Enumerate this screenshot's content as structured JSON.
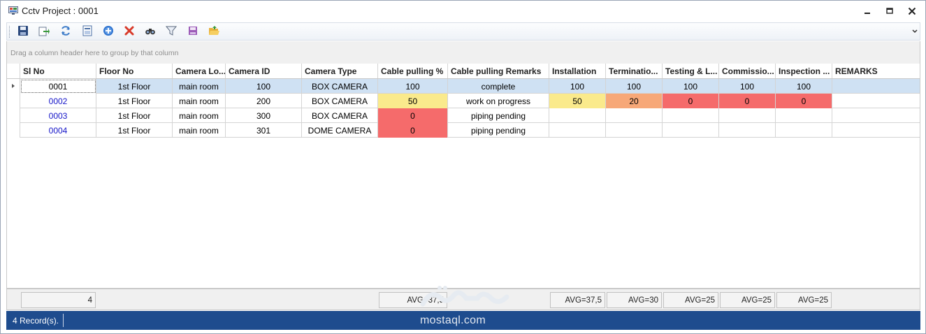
{
  "window": {
    "title": "Cctv Project : 0001"
  },
  "toolbar": {
    "items": [
      "save-icon",
      "export-icon",
      "refresh-icon",
      "report-icon",
      "add-icon",
      "delete-icon",
      "find-icon",
      "filter-icon",
      "layout-icon",
      "open-folder-icon"
    ]
  },
  "group_panel": {
    "hint": "Drag a column header here to group by that column"
  },
  "grid": {
    "columns": [
      "Sl No",
      "Floor No",
      "Camera Lo...",
      "Camera ID",
      "Camera Type",
      "Cable pulling %",
      "Cable pulling Remarks",
      "Installation",
      "Terminatio...",
      "Testing & L...",
      "Commissio...",
      "Inspection ...",
      "REMARKS"
    ],
    "rows": [
      {
        "sl": "0001",
        "floor": "1st Floor",
        "location": "main room",
        "camera_id": "100",
        "camera_type": "BOX CAMERA",
        "cable_pct": "100",
        "cable_remarks": "complete",
        "installation": "100",
        "termination": "100",
        "testing": "100",
        "commissioning": "100",
        "inspection": "100",
        "remarks": ""
      },
      {
        "sl": "0002",
        "floor": "1st Floor",
        "location": "main room",
        "camera_id": "200",
        "camera_type": "BOX CAMERA",
        "cable_pct": "50",
        "cable_remarks": "work on progress",
        "installation": "50",
        "termination": "20",
        "testing": "0",
        "commissioning": "0",
        "inspection": "0",
        "remarks": ""
      },
      {
        "sl": "0003",
        "floor": "1st Floor",
        "location": "main room",
        "camera_id": "300",
        "camera_type": "BOX CAMERA",
        "cable_pct": "0",
        "cable_remarks": "piping pending",
        "installation": "",
        "termination": "",
        "testing": "",
        "commissioning": "",
        "inspection": "",
        "remarks": ""
      },
      {
        "sl": "0004",
        "floor": "1st Floor",
        "location": "main room",
        "camera_id": "301",
        "camera_type": "DOME CAMERA",
        "cable_pct": "0",
        "cable_remarks": "piping pending",
        "installation": "",
        "termination": "",
        "testing": "",
        "commissioning": "",
        "inspection": "",
        "remarks": ""
      }
    ]
  },
  "summary": {
    "count": "4",
    "cable_pct": "AVG=37,5",
    "installation": "AVG=37,5",
    "termination": "AVG=30",
    "testing": "AVG=25",
    "commissioning": "AVG=25",
    "inspection": "AVG=25"
  },
  "status": {
    "records": "4 Record(s)."
  },
  "watermark": {
    "text": "mostaql.com"
  },
  "colors": {
    "status_bar": "#1e4c8e",
    "selected_row": "#cfe1f3",
    "progress_yellow": "#faea8c",
    "progress_orange": "#f7a878",
    "progress_red": "#f56b6b",
    "link_blue": "#1515c8"
  }
}
